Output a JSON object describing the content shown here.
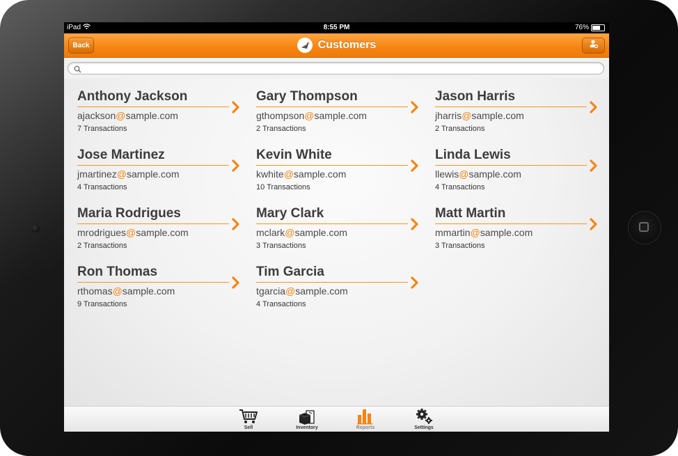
{
  "status_bar": {
    "device": "iPad",
    "time": "8:55 PM",
    "battery": "76%",
    "battery_level": 0.76
  },
  "nav": {
    "back_label": "Back",
    "title": "Customers"
  },
  "search": {
    "placeholder": "",
    "value": ""
  },
  "customers": [
    {
      "name": "Anthony Jackson",
      "email_user": "ajackson",
      "email_at": "@",
      "email_domain": "sample.com",
      "transactions": "7 Transactions"
    },
    {
      "name": "Gary Thompson",
      "email_user": "gthompson",
      "email_at": "@",
      "email_domain": "sample.com",
      "transactions": "2 Transactions"
    },
    {
      "name": "Jason Harris",
      "email_user": "jharris",
      "email_at": "@",
      "email_domain": "sample.com",
      "transactions": "2 Transactions"
    },
    {
      "name": "Jose Martinez",
      "email_user": "jmartinez",
      "email_at": "@",
      "email_domain": "sample.com",
      "transactions": "4 Transactions"
    },
    {
      "name": "Kevin White",
      "email_user": "kwhite",
      "email_at": "@",
      "email_domain": "sample.com",
      "transactions": "10 Transactions"
    },
    {
      "name": "Linda Lewis",
      "email_user": "llewis",
      "email_at": "@",
      "email_domain": "sample.com",
      "transactions": "4 Transactions"
    },
    {
      "name": "Maria Rodrigues",
      "email_user": "mrodrigues",
      "email_at": "@",
      "email_domain": "sample.com",
      "transactions": "2 Transactions"
    },
    {
      "name": "Mary Clark",
      "email_user": "mclark",
      "email_at": "@",
      "email_domain": "sample.com",
      "transactions": "3 Transactions"
    },
    {
      "name": "Matt Martin",
      "email_user": "mmartin",
      "email_at": "@",
      "email_domain": "sample.com",
      "transactions": "3 Transactions"
    },
    {
      "name": "Ron Thomas",
      "email_user": "rthomas",
      "email_at": "@",
      "email_domain": "sample.com",
      "transactions": "9 Transactions"
    },
    {
      "name": "Tim Garcia",
      "email_user": "tgarcia",
      "email_at": "@",
      "email_domain": "sample.com",
      "transactions": "4 Transactions"
    }
  ],
  "tabs": [
    {
      "label": "Sell",
      "icon": "cart-icon"
    },
    {
      "label": "Inventory",
      "icon": "box-icon"
    },
    {
      "label": "Reports",
      "icon": "bar-chart-icon",
      "active": true
    },
    {
      "label": "Settings",
      "icon": "gears-icon"
    }
  ],
  "colors": {
    "accent": "#f58412",
    "nav_top": "#ffa640",
    "text": "#3c3c3c"
  }
}
